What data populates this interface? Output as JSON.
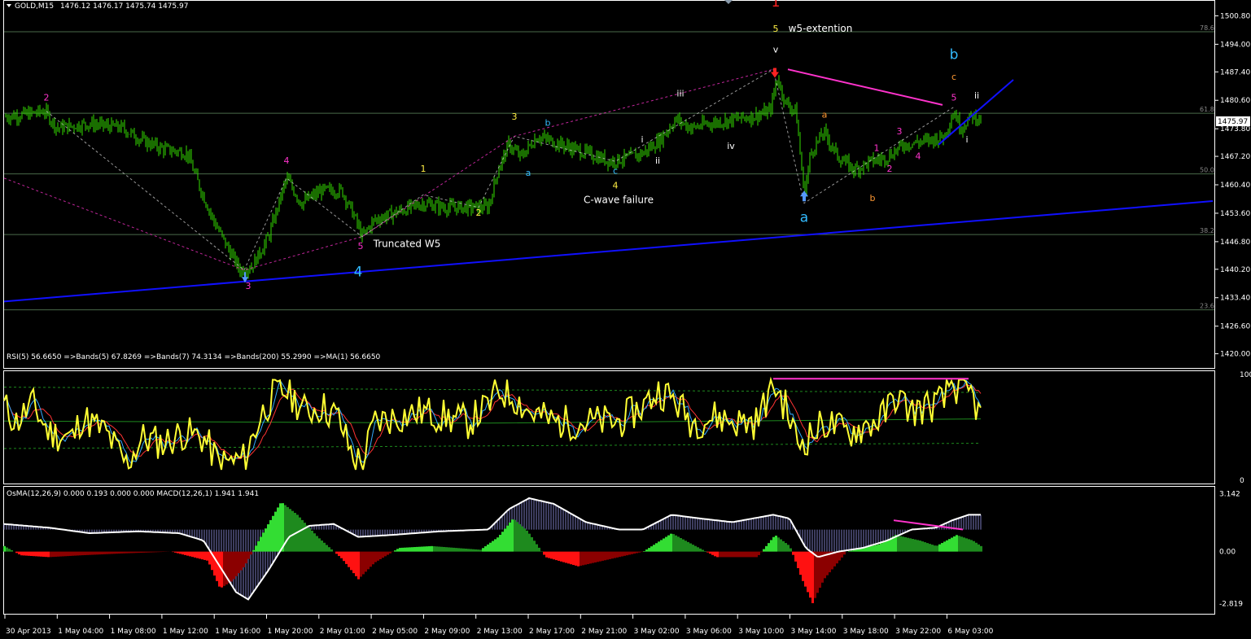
{
  "header": {
    "symbol": "GOLD,M15",
    "quote": "1476.12 1476.17 1475.74 1475.97",
    "current_price": "1475.97"
  },
  "colors": {
    "background": "#000000",
    "candle": "#33dd00",
    "trendline": "#1010ff",
    "level_line": "#4a6a4a",
    "wave_magenta": "#ff33cc",
    "wave_yellow": "#ffee44",
    "wave_cyan": "#33bbff",
    "wave_red": "#ff2222",
    "wave_orange": "#ff9933",
    "rsi_line": "#ffff33",
    "osma_pos": "#33cc33",
    "osma_neg": "#ff1111",
    "macd_hist": "#9999ee",
    "macd_line": "#ffffff"
  },
  "chart_data": [
    {
      "type": "candlestick",
      "title": "GOLD,M15",
      "y_ticks": [
        "1500.80",
        "1494.00",
        "1487.40",
        "1480.60",
        "1473.80",
        "1467.20",
        "1460.40",
        "1453.60",
        "1446.80",
        "1440.20",
        "1433.40",
        "1426.60",
        "1420.00"
      ],
      "ylim": [
        1417,
        1504
      ],
      "fib_levels": [
        {
          "label": "78.6",
          "price": 1497.0
        },
        {
          "label": "61.8",
          "price": 1477.5
        },
        {
          "label": "50.0",
          "price": 1463.0
        },
        {
          "label": "38.2",
          "price": 1448.5
        },
        {
          "label": "23.6",
          "price": 1430.5
        }
      ],
      "close_path": [
        [
          0,
          1476.5
        ],
        [
          40,
          1477.5
        ],
        [
          55,
          1478
        ],
        [
          70,
          1474
        ],
        [
          110,
          1475
        ],
        [
          150,
          1474
        ],
        [
          175,
          1471
        ],
        [
          200,
          1469
        ],
        [
          230,
          1468
        ],
        [
          245,
          1460
        ],
        [
          262,
          1452
        ],
        [
          278,
          1446
        ],
        [
          295,
          1440
        ],
        [
          310,
          1441
        ],
        [
          330,
          1448
        ],
        [
          352,
          1462
        ],
        [
          370,
          1456
        ],
        [
          395,
          1459
        ],
        [
          420,
          1459
        ],
        [
          435,
          1453
        ],
        [
          445,
          1448
        ],
        [
          460,
          1452
        ],
        [
          490,
          1454
        ],
        [
          520,
          1456
        ],
        [
          545,
          1455
        ],
        [
          575,
          1455
        ],
        [
          600,
          1455
        ],
        [
          612,
          1464
        ],
        [
          625,
          1470
        ],
        [
          640,
          1467
        ],
        [
          660,
          1472
        ],
        [
          690,
          1470
        ],
        [
          720,
          1468
        ],
        [
          750,
          1466
        ],
        [
          775,
          1467
        ],
        [
          790,
          1468
        ],
        [
          810,
          1471
        ],
        [
          830,
          1476
        ],
        [
          850,
          1474
        ],
        [
          870,
          1475
        ],
        [
          900,
          1476
        ],
        [
          930,
          1477
        ],
        [
          946,
          1478
        ],
        [
          955,
          1486
        ],
        [
          965,
          1480
        ],
        [
          978,
          1478
        ],
        [
          988,
          1458
        ],
        [
          996,
          1468
        ],
        [
          1012,
          1473
        ],
        [
          1030,
          1467
        ],
        [
          1050,
          1464
        ],
        [
          1070,
          1466
        ],
        [
          1090,
          1467
        ],
        [
          1110,
          1470
        ],
        [
          1140,
          1471
        ],
        [
          1160,
          1472
        ],
        [
          1172,
          1478
        ],
        [
          1180,
          1474
        ],
        [
          1195,
          1477
        ],
        [
          1205,
          1476
        ]
      ],
      "trendlines": [
        {
          "from": [
            5,
            1432.5
          ],
          "to": [
            1490,
            1456.5
          ],
          "color": "blue"
        },
        {
          "from": [
            1153,
            1470
          ],
          "to": [
            1245,
            1485.5
          ],
          "color": "blue"
        },
        {
          "from": [
            968,
            1488
          ],
          "to": [
            1158,
            1479.5
          ],
          "color": "magenta"
        }
      ],
      "wave_labels": [
        {
          "text": "2",
          "x": 57,
          "price": 1480.5,
          "color": "magenta"
        },
        {
          "text": "4",
          "x": 352,
          "price": 1465.5,
          "color": "magenta"
        },
        {
          "text": "5",
          "x": 443,
          "price": 1445,
          "color": "magenta"
        },
        {
          "text": "3",
          "x": 305,
          "price": 1435.5,
          "color": "magenta"
        },
        {
          "text": "4",
          "x": 440,
          "price": 1438.5,
          "color": "cyan",
          "big": true
        },
        {
          "text": "Truncated W5",
          "x": 500,
          "price": 1445.5,
          "color": "white"
        },
        {
          "text": "1",
          "x": 520,
          "price": 1463.5,
          "color": "yellow"
        },
        {
          "text": "2",
          "x": 588,
          "price": 1453.0,
          "color": "yellow"
        },
        {
          "text": "3",
          "x": 632,
          "price": 1476.0,
          "color": "yellow"
        },
        {
          "text": "a",
          "x": 649,
          "price": 1462.5,
          "color": "cyan"
        },
        {
          "text": "b",
          "x": 673,
          "price": 1474.5,
          "color": "cyan"
        },
        {
          "text": "c",
          "x": 756,
          "price": 1463.0,
          "color": "cyan"
        },
        {
          "text": "4",
          "x": 756,
          "price": 1459.5,
          "color": "yellow"
        },
        {
          "text": "C-wave failure",
          "x": 760,
          "price": 1456.0,
          "color": "white"
        },
        {
          "text": "iii",
          "x": 836,
          "price": 1481.5,
          "color": "white"
        },
        {
          "text": "i",
          "x": 789,
          "price": 1470.5,
          "color": "white"
        },
        {
          "text": "ii",
          "x": 808,
          "price": 1465.5,
          "color": "white"
        },
        {
          "text": "iv",
          "x": 898,
          "price": 1469.0,
          "color": "white"
        },
        {
          "text": "1",
          "x": 953,
          "price": 1503.0,
          "color": "red",
          "big": true
        },
        {
          "text": "5",
          "x": 953,
          "price": 1497.0,
          "color": "yellow"
        },
        {
          "text": "w5-extention",
          "x": 1008,
          "price": 1497.0,
          "color": "white"
        },
        {
          "text": "v",
          "x": 953,
          "price": 1492.0,
          "color": "white"
        },
        {
          "text": "a",
          "x": 988,
          "price": 1451.5,
          "color": "cyan",
          "big": true
        },
        {
          "text": "a",
          "x": 1013,
          "price": 1476.5,
          "color": "orange"
        },
        {
          "text": "b",
          "x": 1072,
          "price": 1456.5,
          "color": "orange"
        },
        {
          "text": "1",
          "x": 1077,
          "price": 1468.5,
          "color": "magenta"
        },
        {
          "text": "2",
          "x": 1093,
          "price": 1463.5,
          "color": "magenta"
        },
        {
          "text": "3",
          "x": 1105,
          "price": 1472.5,
          "color": "magenta"
        },
        {
          "text": "4",
          "x": 1128,
          "price": 1466.5,
          "color": "magenta"
        },
        {
          "text": "b",
          "x": 1172,
          "price": 1490.5,
          "color": "cyan",
          "big": true
        },
        {
          "text": "c",
          "x": 1172,
          "price": 1485.5,
          "color": "orange"
        },
        {
          "text": "5",
          "x": 1172,
          "price": 1480.5,
          "color": "magenta"
        },
        {
          "text": "ii",
          "x": 1200,
          "price": 1481.0,
          "color": "white"
        },
        {
          "text": "i",
          "x": 1188,
          "price": 1470.5,
          "color": "white"
        }
      ]
    },
    {
      "type": "line",
      "title": "RSI(5) 56.6650  =>Bands(5) 67.8269  =>Bands(7) 74.3134  =>Bands(200) 55.2990  =>MA(1) 56.6650",
      "y_ticks": [
        "100",
        "0"
      ],
      "ylim": [
        0,
        100
      ],
      "rsi_anchors": [
        [
          5,
          70
        ],
        [
          20,
          55
        ],
        [
          40,
          72
        ],
        [
          60,
          45
        ],
        [
          90,
          40
        ],
        [
          100,
          60
        ],
        [
          130,
          45
        ],
        [
          155,
          15
        ],
        [
          175,
          40
        ],
        [
          200,
          35
        ],
        [
          225,
          45
        ],
        [
          250,
          40
        ],
        [
          270,
          15
        ],
        [
          300,
          20
        ],
        [
          320,
          60
        ],
        [
          335,
          80
        ],
        [
          352,
          85
        ],
        [
          375,
          65
        ],
        [
          395,
          70
        ],
        [
          415,
          60
        ],
        [
          432,
          25
        ],
        [
          445,
          15
        ],
        [
          460,
          55
        ],
        [
          490,
          60
        ],
        [
          520,
          65
        ],
        [
          545,
          60
        ],
        [
          575,
          55
        ],
        [
          600,
          70
        ],
        [
          612,
          85
        ],
        [
          630,
          80
        ],
        [
          650,
          65
        ],
        [
          680,
          55
        ],
        [
          720,
          55
        ],
        [
          760,
          55
        ],
        [
          790,
          70
        ],
        [
          810,
          85
        ],
        [
          830,
          75
        ],
        [
          850,
          55
        ],
        [
          880,
          60
        ],
        [
          905,
          55
        ],
        [
          930,
          55
        ],
        [
          950,
          92
        ],
        [
          965,
          70
        ],
        [
          980,
          35
        ],
        [
          995,
          42
        ],
        [
          1015,
          55
        ],
        [
          1040,
          45
        ],
        [
          1060,
          50
        ],
        [
          1085,
          60
        ],
        [
          1100,
          80
        ],
        [
          1120,
          65
        ],
        [
          1140,
          70
        ],
        [
          1160,
          75
        ],
        [
          1167,
          93
        ],
        [
          1180,
          85
        ],
        [
          1195,
          80
        ],
        [
          1205,
          58
        ]
      ],
      "divergence_line": {
        "from": [
          950,
          96
        ],
        "to": [
          1190,
          96
        ]
      }
    },
    {
      "type": "bar",
      "title": "OsMA(12,26,9) 0.000 0.193 0.000 0.000  MACD(12,26,1) 1.941 1.941",
      "y_ticks": [
        "3.142",
        "0.00",
        "-2.819"
      ],
      "ylim": [
        -3.2,
        3.3
      ],
      "macd_anchors": [
        [
          5,
          1.5
        ],
        [
          60,
          1.3
        ],
        [
          110,
          1.0
        ],
        [
          170,
          1.1
        ],
        [
          220,
          1.0
        ],
        [
          250,
          0.6
        ],
        [
          270,
          -0.8
        ],
        [
          290,
          -2.2
        ],
        [
          305,
          -2.6
        ],
        [
          330,
          -1.0
        ],
        [
          355,
          0.8
        ],
        [
          380,
          1.4
        ],
        [
          410,
          1.5
        ],
        [
          440,
          0.8
        ],
        [
          480,
          0.9
        ],
        [
          540,
          1.1
        ],
        [
          600,
          1.2
        ],
        [
          625,
          2.3
        ],
        [
          650,
          2.9
        ],
        [
          680,
          2.6
        ],
        [
          720,
          1.6
        ],
        [
          760,
          1.2
        ],
        [
          790,
          1.2
        ],
        [
          825,
          2.0
        ],
        [
          860,
          1.8
        ],
        [
          900,
          1.6
        ],
        [
          950,
          2.0
        ],
        [
          970,
          1.8
        ],
        [
          990,
          0.2
        ],
        [
          1005,
          -0.3
        ],
        [
          1030,
          0.0
        ],
        [
          1060,
          0.2
        ],
        [
          1090,
          0.6
        ],
        [
          1120,
          1.2
        ],
        [
          1150,
          1.3
        ],
        [
          1170,
          1.7
        ],
        [
          1190,
          2.0
        ],
        [
          1205,
          2.0
        ]
      ],
      "osma_anchors": [
        [
          5,
          0.3
        ],
        [
          25,
          -0.2
        ],
        [
          60,
          -0.3
        ],
        [
          100,
          -0.2
        ],
        [
          150,
          -0.1
        ],
        [
          210,
          0.0
        ],
        [
          255,
          -0.5
        ],
        [
          270,
          -2.0
        ],
        [
          285,
          -1.6
        ],
        [
          300,
          -0.8
        ],
        [
          320,
          0.8
        ],
        [
          345,
          2.7
        ],
        [
          365,
          2.0
        ],
        [
          390,
          0.8
        ],
        [
          420,
          -0.4
        ],
        [
          440,
          -1.5
        ],
        [
          460,
          -0.6
        ],
        [
          490,
          0.2
        ],
        [
          530,
          0.3
        ],
        [
          590,
          0.1
        ],
        [
          612,
          0.8
        ],
        [
          630,
          1.8
        ],
        [
          648,
          1.1
        ],
        [
          670,
          -0.3
        ],
        [
          710,
          -0.8
        ],
        [
          750,
          -0.4
        ],
        [
          790,
          0.0
        ],
        [
          825,
          1.0
        ],
        [
          850,
          0.4
        ],
        [
          880,
          -0.3
        ],
        [
          930,
          -0.3
        ],
        [
          952,
          0.9
        ],
        [
          970,
          0.3
        ],
        [
          985,
          -1.5
        ],
        [
          998,
          -2.8
        ],
        [
          1012,
          -1.5
        ],
        [
          1040,
          0.0
        ],
        [
          1080,
          0.4
        ],
        [
          1100,
          0.9
        ],
        [
          1130,
          0.6
        ],
        [
          1150,
          0.3
        ],
        [
          1175,
          0.9
        ],
        [
          1195,
          0.6
        ],
        [
          1205,
          0.3
        ]
      ],
      "divergence_line": {
        "from": [
          1098,
          1.7
        ],
        "to": [
          1183,
          1.2
        ]
      }
    }
  ],
  "x_axis": {
    "labels": [
      "30 Apr 2013",
      "1 May 04:00",
      "1 May 08:00",
      "1 May 12:00",
      "1 May 16:00",
      "1 May 20:00",
      "2 May 01:00",
      "2 May 05:00",
      "2 May 09:00",
      "2 May 13:00",
      "2 May 17:00",
      "2 May 21:00",
      "3 May 02:00",
      "3 May 06:00",
      "3 May 10:00",
      "3 May 14:00",
      "3 May 18:00",
      "3 May 22:00",
      "6 May 03:00"
    ]
  }
}
